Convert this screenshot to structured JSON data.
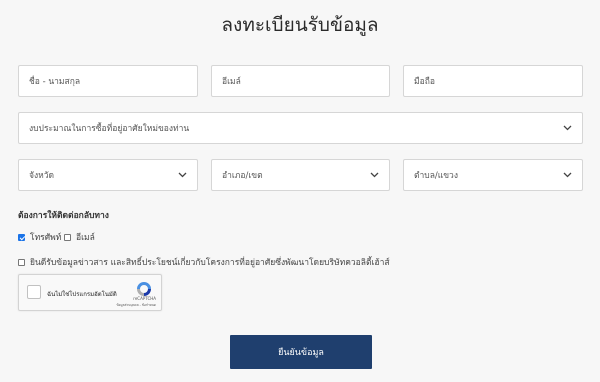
{
  "form": {
    "title": "ลงทะเบียนรับข้อมูล",
    "fields": {
      "name": "ชื่อ - นามสกุล",
      "email": "อีเมล์",
      "phone": "มือถือ",
      "budget": "งบประมาณในการซื้อที่อยู่อาศัยใหม่ของท่าน",
      "province": "จังหวัด",
      "district": "อำเภอ/เขต",
      "subdistrict": "ตำบล/แขวง"
    },
    "contact": {
      "label": "ต้องการให้ติดต่อกลับทาง",
      "phone_label": "โทรศัพท์",
      "phone_checked": true,
      "email_label": "อีเมล์",
      "email_checked": false
    },
    "consent": {
      "label": "ยินดีรับข้อมูลข่าวสาร และสิทธิ์ประโยชน์เกี่ยวกับโครงการที่อยู่อาศัยซึ่งพัฒนาโดยบริษัทควอลิตี้เฮ้าส์",
      "checked": false
    },
    "captcha": {
      "label": "ฉันไม่ใช่โปรแกรมอัตโนมัติ",
      "brand": "reCAPTCHA",
      "links": "ข้อมูลส่วนบุคคล - ข้อกำหนด"
    },
    "submit_label": "ยืนยันข้อมูล"
  },
  "colors": {
    "background": "#f7f7f7",
    "button": "#1f3f6e",
    "checkbox_checked": "#1a73e8"
  },
  "icons": {
    "select_arrow": "chevron-down-icon",
    "captcha_logo": "recaptcha-icon"
  }
}
